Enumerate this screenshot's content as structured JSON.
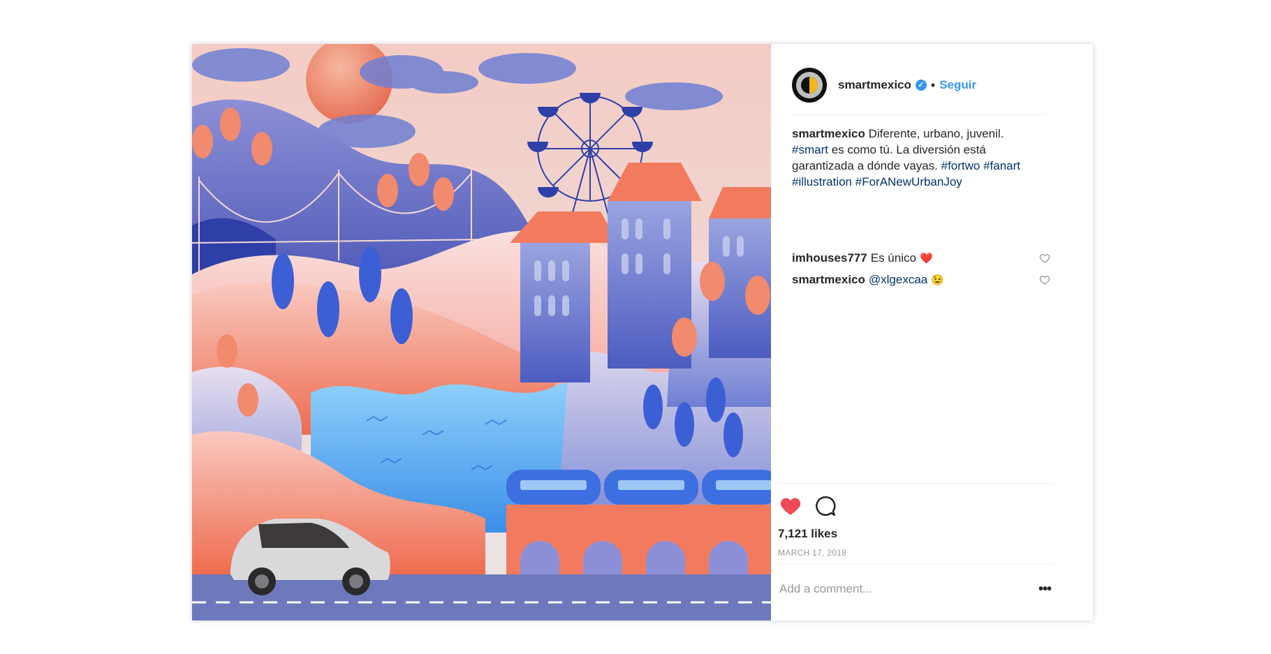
{
  "post": {
    "image": {
      "alt_subject": "illustration",
      "colors": {
        "sky": "#ead7d3",
        "coral": "#f27b5f",
        "blue_dark": "#2f3fa8",
        "blue_mid": "#5b6fd1",
        "blue_light": "#9fb0e8",
        "water": "#52a9f2",
        "road": "#6d79bb"
      }
    },
    "header": {
      "username": "smartmexico",
      "verified_icon": "verified-badge-icon",
      "separator": "•",
      "follow_label": "Seguir"
    },
    "caption": {
      "username": "smartmexico",
      "text_1": " Diferente, urbano, juvenil. ",
      "tag_smart": "#smart",
      "text_2": " es como tú. La diversión está garantizada a dónde vayas. ",
      "tag_fortwo": "#fortwo",
      "tag_fanart": "#fanart",
      "tag_illustration": "#illustration",
      "tag_urbanjoy": "#ForANewUrbanJoy"
    },
    "comments": [
      {
        "username": "imhouses777",
        "text": "Es único",
        "emoji": "❤️"
      },
      {
        "username": "smartmexico",
        "mention": "@xlgexcaa",
        "emoji": "😉"
      }
    ],
    "actions": {
      "like_icon": "heart-filled-icon",
      "comment_icon": "comment-bubble-icon",
      "liked": true
    },
    "likes": "7,121 likes",
    "date": "MARCH 17, 2018",
    "add_comment_placeholder": "Add a comment...",
    "more_label": "•••"
  }
}
